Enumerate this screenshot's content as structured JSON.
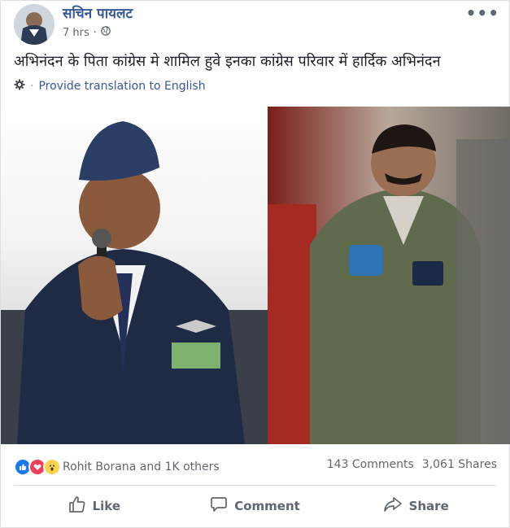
{
  "author": {
    "name": "सचिन पायलट"
  },
  "post_meta": {
    "time": "7 hrs",
    "separator": "·",
    "privacy_icon": "globe-icon"
  },
  "more_label": "•••",
  "post_text": "अभिनंदन के पिता कांग्रेस मे शामिल हुवे इनका कांग्रेस परिवार में हार्दिक अभिनंदन",
  "translate": {
    "icon": "gear-icon",
    "dot": "·",
    "label": "Provide translation to English"
  },
  "reactions": {
    "icons": [
      "like-icon",
      "love-icon",
      "wow-icon"
    ],
    "label": "Rohit Borana and 1K others"
  },
  "counts": {
    "comments": "143 Comments",
    "shares": "3,061 Shares"
  },
  "actions": {
    "like": "Like",
    "comment": "Comment",
    "share": "Share"
  },
  "colors": {
    "link": "#365899",
    "like_blue": "#1877f2",
    "love_red": "#f33e58",
    "wow_yellow": "#fcd34d",
    "text": "#1d2129",
    "muted": "#616770"
  }
}
